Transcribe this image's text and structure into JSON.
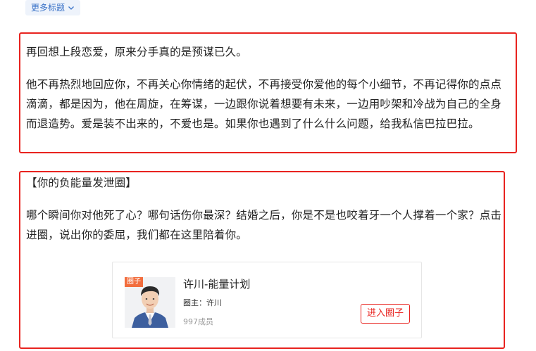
{
  "more_titles": {
    "label": "更多标题",
    "icon": "chevron-down-icon"
  },
  "post": {
    "paragraph1": "再回想上段恋爱，原来分手真的是预谋已久。",
    "paragraph2": "他不再热烈地回应你，不再关心你情绪的起伏，不再接受你爱他的每个小细节，不再记得你的点点滴滴，都是因为，他在周旋，在筹谋，一边跟你说着想要有未来，一边用吵架和冷战为自己的全身而退造势。爱是装不出来的，不爱也是。如果你也遇到了什么什么问题，给我私信巴拉巴拉。"
  },
  "circle_section": {
    "heading": "【你的负能量发泄圈】",
    "description": "哪个瞬间你对他死了心？哪句话伤你最深？结婚之后，你是不是也咬着牙一个人撑着一个家？点击进圈，说出你的委屈，我们都在这里陪着你。",
    "card": {
      "badge": "圈子",
      "name": "许川-能量计划",
      "owner": "圈主：许川",
      "members": "997成员",
      "join_label": "进入圈子"
    }
  },
  "colors": {
    "highlight_border": "#e8231f",
    "link_blue": "#3b73c8",
    "badge_orange": "#f26d3d"
  }
}
